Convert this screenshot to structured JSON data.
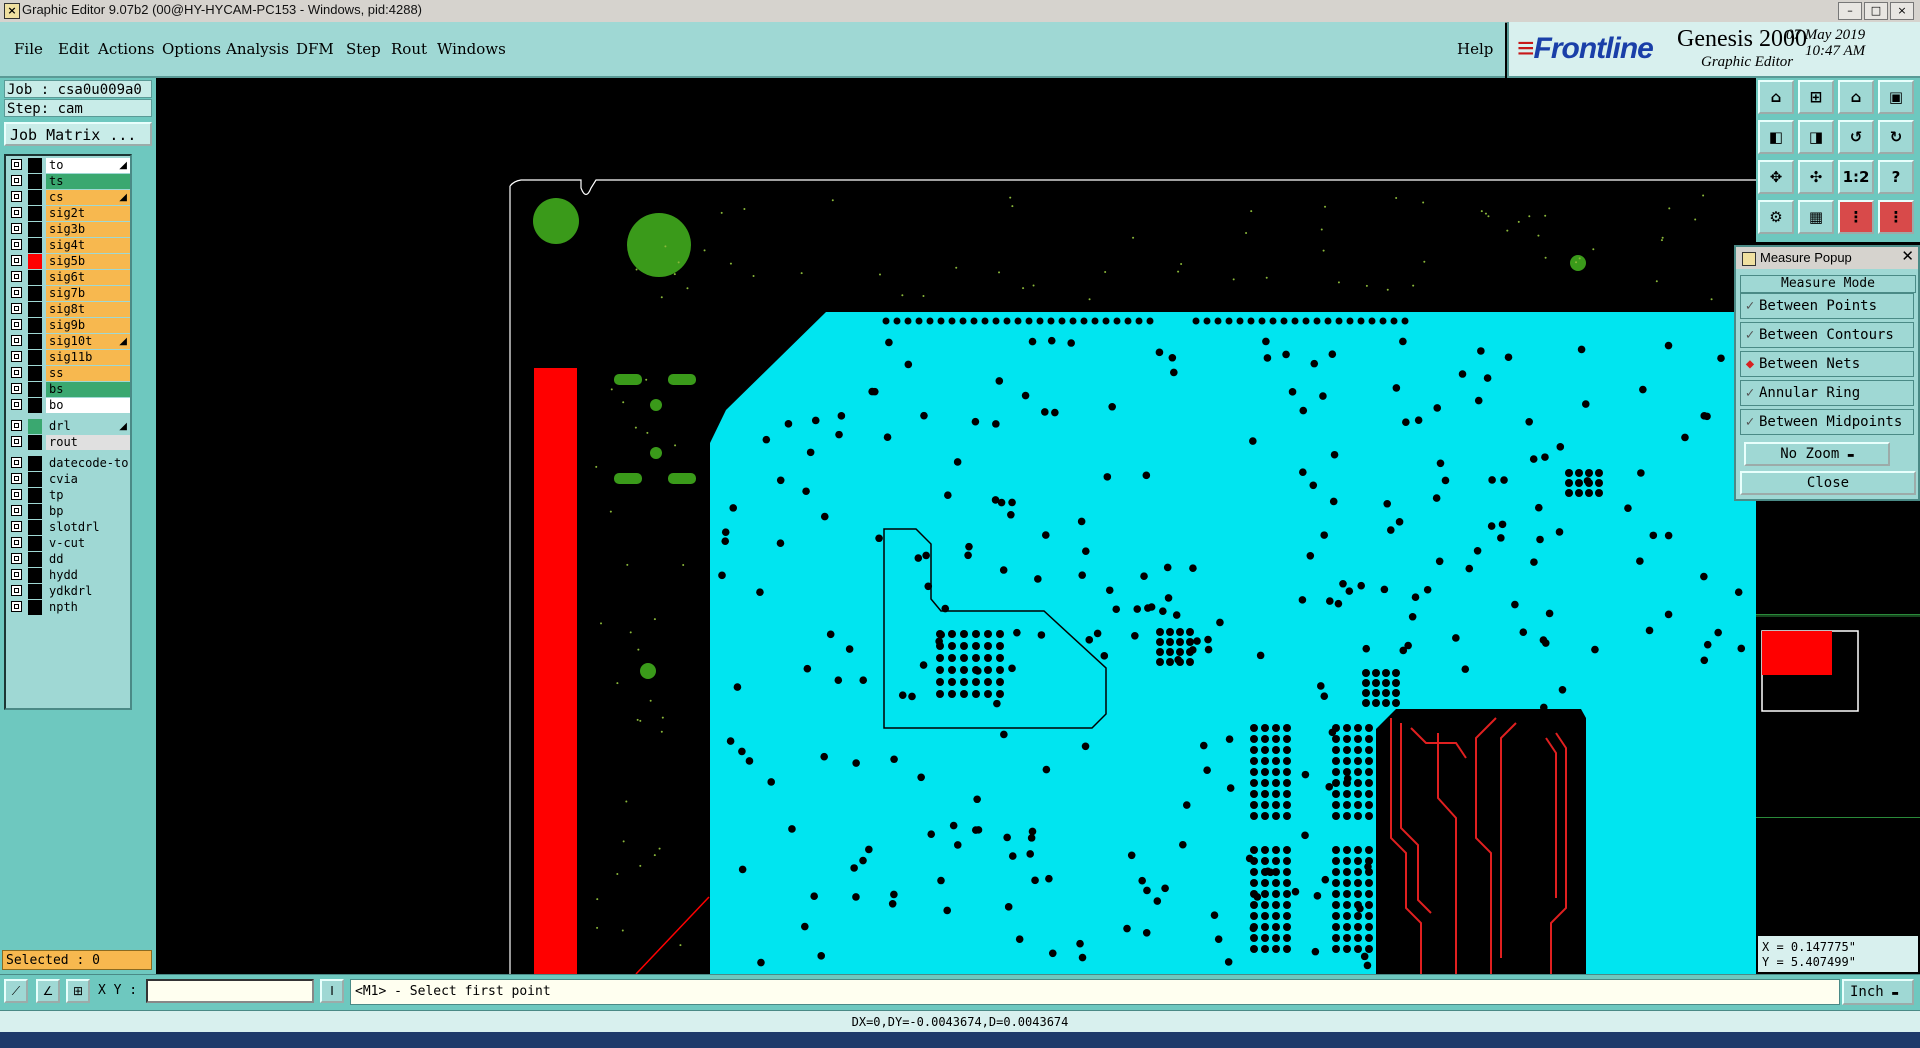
{
  "window": {
    "title": "Graphic Editor 9.07b2 (00@HY-HYCAM-PC153 - Windows, pid:4288)"
  },
  "menu": {
    "items": [
      "File",
      "Edit",
      "Actions",
      "Options",
      "Analysis",
      "DFM",
      "Step",
      "Rout",
      "Windows"
    ],
    "help": "Help"
  },
  "brand": {
    "logo": "Frontline",
    "product": "Genesis 2000",
    "subtitle": "Graphic Editor",
    "date": "07 May 2019",
    "time": "10:47 AM"
  },
  "job": {
    "job_label": "Job : csa0u009a0",
    "step_label": "Step: cam",
    "matrix_button": "Job Matrix ..."
  },
  "layers": [
    {
      "name": "to",
      "bg": "#ffffff",
      "swatch": "#000000",
      "arrow": true
    },
    {
      "name": "ts",
      "bg": "#3aa870",
      "swatch": "#000000",
      "arrow": false
    },
    {
      "name": "cs",
      "bg": "#f7b84f",
      "swatch": "#000000",
      "arrow": true
    },
    {
      "name": "sig2t",
      "bg": "#f7b84f",
      "swatch": "#000000",
      "arrow": false
    },
    {
      "name": "sig3b",
      "bg": "#f7b84f",
      "swatch": "#000000",
      "arrow": false
    },
    {
      "name": "sig4t",
      "bg": "#f7b84f",
      "swatch": "#000000",
      "arrow": false
    },
    {
      "name": "sig5b",
      "bg": "#f7b84f",
      "swatch": "#ff0000",
      "arrow": false
    },
    {
      "name": "sig6t",
      "bg": "#f7b84f",
      "swatch": "#000000",
      "arrow": false
    },
    {
      "name": "sig7b",
      "bg": "#f7b84f",
      "swatch": "#000000",
      "arrow": false
    },
    {
      "name": "sig8t",
      "bg": "#f7b84f",
      "swatch": "#000000",
      "arrow": false
    },
    {
      "name": "sig9b",
      "bg": "#f7b84f",
      "swatch": "#000000",
      "arrow": false
    },
    {
      "name": "sig10t",
      "bg": "#f7b84f",
      "swatch": "#000000",
      "arrow": true
    },
    {
      "name": "sig11b",
      "bg": "#f7b84f",
      "swatch": "#000000",
      "arrow": false
    },
    {
      "name": "ss",
      "bg": "#f7b84f",
      "swatch": "#000000",
      "arrow": false
    },
    {
      "name": "bs",
      "bg": "#3aa870",
      "swatch": "#000000",
      "arrow": false
    },
    {
      "name": "bo",
      "bg": "#ffffff",
      "swatch": "#000000",
      "arrow": false
    },
    {
      "name": "drl",
      "bg": "#9fd8d4",
      "swatch": "#3aa870",
      "arrow": true
    },
    {
      "name": "rout",
      "bg": "#e0e0e0",
      "swatch": "#000000",
      "arrow": false
    },
    {
      "name": "datecode-to",
      "bg": "#9fd8d4",
      "swatch": "#000000",
      "arrow": false
    },
    {
      "name": "cvia",
      "bg": "#9fd8d4",
      "swatch": "#000000",
      "arrow": false
    },
    {
      "name": "tp",
      "bg": "#9fd8d4",
      "swatch": "#000000",
      "arrow": false
    },
    {
      "name": "bp",
      "bg": "#9fd8d4",
      "swatch": "#000000",
      "arrow": false
    },
    {
      "name": "slotdrl",
      "bg": "#9fd8d4",
      "swatch": "#000000",
      "arrow": false
    },
    {
      "name": "v-cut",
      "bg": "#9fd8d4",
      "swatch": "#000000",
      "arrow": false
    },
    {
      "name": "dd",
      "bg": "#9fd8d4",
      "swatch": "#000000",
      "arrow": false
    },
    {
      "name": "hydd",
      "bg": "#9fd8d4",
      "swatch": "#000000",
      "arrow": false
    },
    {
      "name": "ydkdrl",
      "bg": "#9fd8d4",
      "swatch": "#000000",
      "arrow": false
    },
    {
      "name": "npth",
      "bg": "#9fd8d4",
      "swatch": "#000000",
      "arrow": false
    }
  ],
  "selected": "Selected : 0",
  "measure": {
    "title": "Measure Popup",
    "header": "Measure Mode",
    "options": [
      {
        "label": "Between Points",
        "active": false
      },
      {
        "label": "Between Contours",
        "active": false
      },
      {
        "label": "Between Nets",
        "active": true
      },
      {
        "label": "Annular Ring",
        "active": false
      },
      {
        "label": "Between Midpoints",
        "active": false
      }
    ],
    "zoom": "No Zoom",
    "close": "Close"
  },
  "toolbar_labels": {
    "ratio": "1:2",
    "help": "?"
  },
  "coords": {
    "x": "X = 0.147775\"",
    "y": "Y = 5.407499\""
  },
  "bottom": {
    "xy_label": "X Y :",
    "xy_value": "",
    "prompt": "<M1> - Select first point",
    "units": "Inch",
    "status": "DX=0,DY=-0.0043674,D=0.0043674"
  },
  "colors": {
    "panel": "#6ec8bf",
    "menu": "#9fd8d4",
    "copper": "#00e5f0",
    "drill": "#3a9a1a",
    "outline_red": "#ff0000"
  }
}
